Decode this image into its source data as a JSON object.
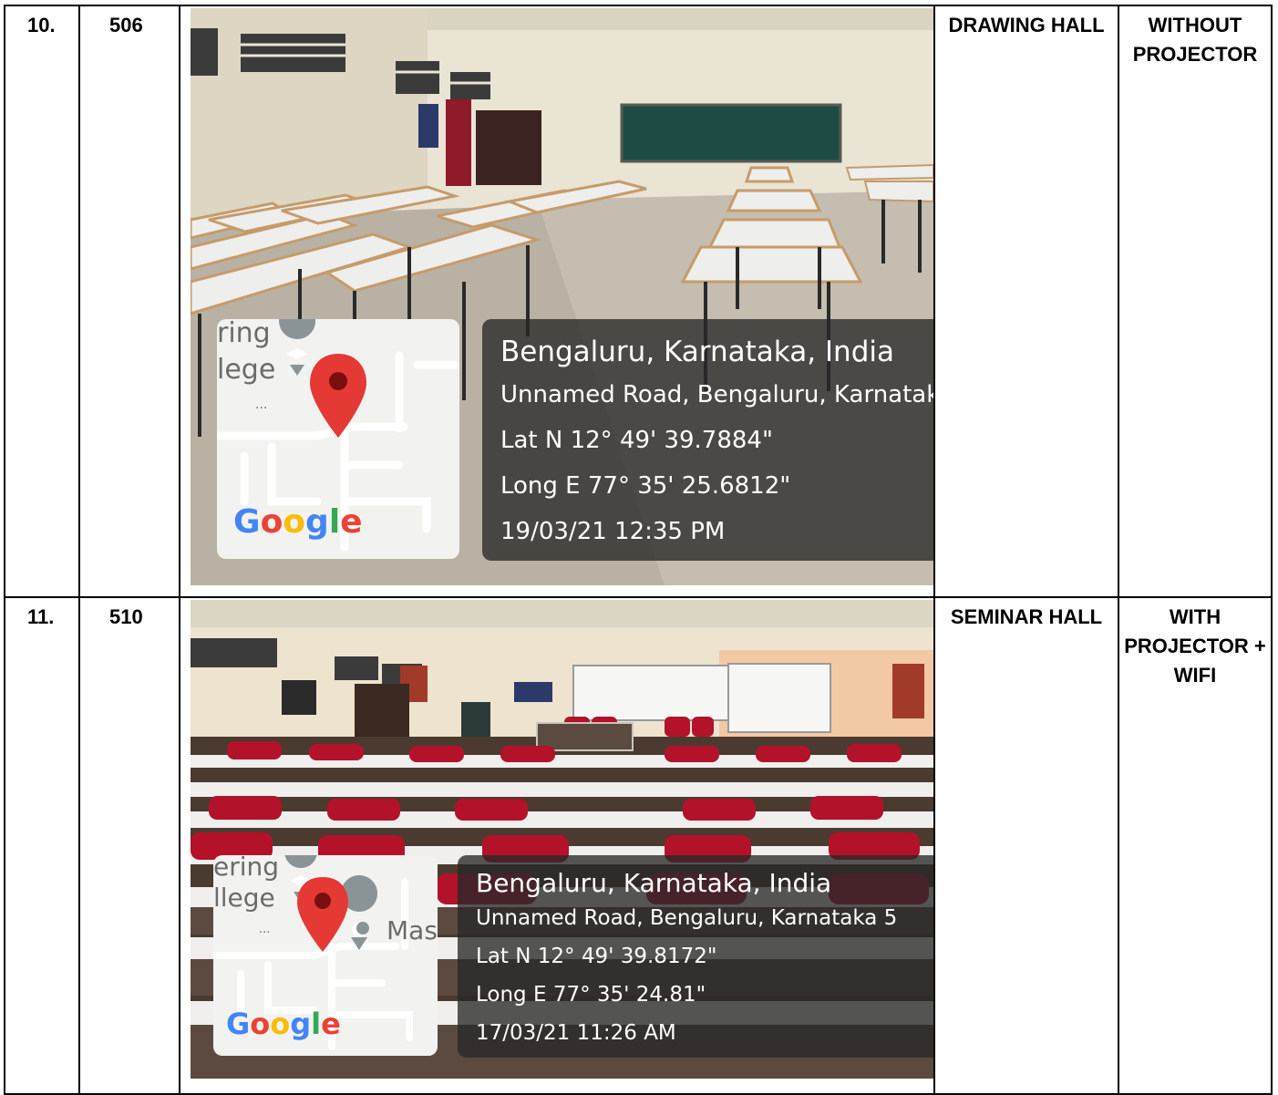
{
  "rows": [
    {
      "sno": "10.",
      "room": "506",
      "type": "DRAWING HALL",
      "projector": "WITHOUT PROJECTOR",
      "photo": {
        "map_labels": [
          "ring",
          "lege",
          "..."
        ],
        "google": [
          "G",
          "o",
          "o",
          "g",
          "l",
          "e"
        ],
        "location": "Bengaluru, Karnataka, India",
        "address": "Unnamed Road, Bengaluru, Karnataka",
        "lat": "Lat N 12° 49' 39.7884\"",
        "long": "Long E 77° 35' 25.6812\"",
        "datetime": "19/03/21 12:35 PM"
      }
    },
    {
      "sno": "11.",
      "room": "510",
      "type": "SEMINAR HALL",
      "projector": "WITH PROJECTOR + WIFI",
      "photo": {
        "map_labels": [
          "ering",
          "llege",
          "...",
          "Mas"
        ],
        "google": [
          "G",
          "o",
          "o",
          "g",
          "l",
          "e"
        ],
        "location": "Bengaluru, Karnataka, India",
        "address": "Unnamed Road, Bengaluru, Karnataka 5",
        "lat": "Lat N 12° 49' 39.8172\"",
        "long": "Long E 77° 35' 24.81\"",
        "datetime": "17/03/21 11:26 AM"
      }
    }
  ],
  "colors": {
    "google": [
      "#4285F4",
      "#EA4335",
      "#FBBC05",
      "#4285F4",
      "#34A853",
      "#EA4335"
    ],
    "pin": "#E53935",
    "chair": "#B3122A",
    "chalkboard": "#1E4C44"
  }
}
